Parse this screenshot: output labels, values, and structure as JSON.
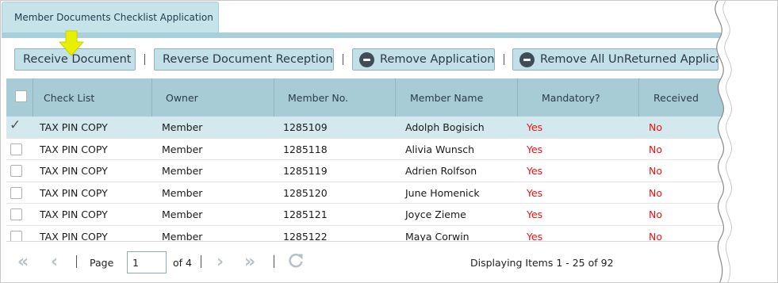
{
  "tab": {
    "title": "Member Documents Checklist Application"
  },
  "toolbar": {
    "receive_label": "Receive Document",
    "reverse_label": "Reverse Document Reception",
    "remove_label": "Remove Application",
    "remove_all_label": "Remove All UnReturned Applica"
  },
  "table": {
    "headers": [
      "Check List",
      "Owner",
      "Member No.",
      "Member Name",
      "Mandatory?",
      "Received"
    ],
    "rows": [
      {
        "checklist": "TAX PIN COPY",
        "owner": "Member",
        "member_no": "1285109",
        "name": "Adolph Bogisich",
        "mandatory": "Yes",
        "received": "No",
        "selected": true
      },
      {
        "checklist": "TAX PIN COPY",
        "owner": "Member",
        "member_no": "1285118",
        "name": "Alivia Wunsch",
        "mandatory": "Yes",
        "received": "No",
        "selected": false
      },
      {
        "checklist": "TAX PIN COPY",
        "owner": "Member",
        "member_no": "1285119",
        "name": "Adrien Rolfson",
        "mandatory": "Yes",
        "received": "No",
        "selected": false
      },
      {
        "checklist": "TAX PIN COPY",
        "owner": "Member",
        "member_no": "1285120",
        "name": "June Homenick",
        "mandatory": "Yes",
        "received": "No",
        "selected": false
      },
      {
        "checklist": "TAX PIN COPY",
        "owner": "Member",
        "member_no": "1285121",
        "name": "Joyce Zieme",
        "mandatory": "Yes",
        "received": "No",
        "selected": false
      },
      {
        "checklist": "TAX PIN COPY",
        "owner": "Member",
        "member_no": "1285122",
        "name": "Maya Corwin",
        "mandatory": "Yes",
        "received": "No",
        "selected": false
      }
    ]
  },
  "pager": {
    "page_label": "Page",
    "page_value": "1",
    "of_label": "of 4",
    "status": "Displaying Items 1 - 25 of 92"
  },
  "colors": {
    "accent": "#a7ccd6",
    "button": "#c3dfe7",
    "negative": "#ee1111",
    "arrow": "#e6f000"
  }
}
